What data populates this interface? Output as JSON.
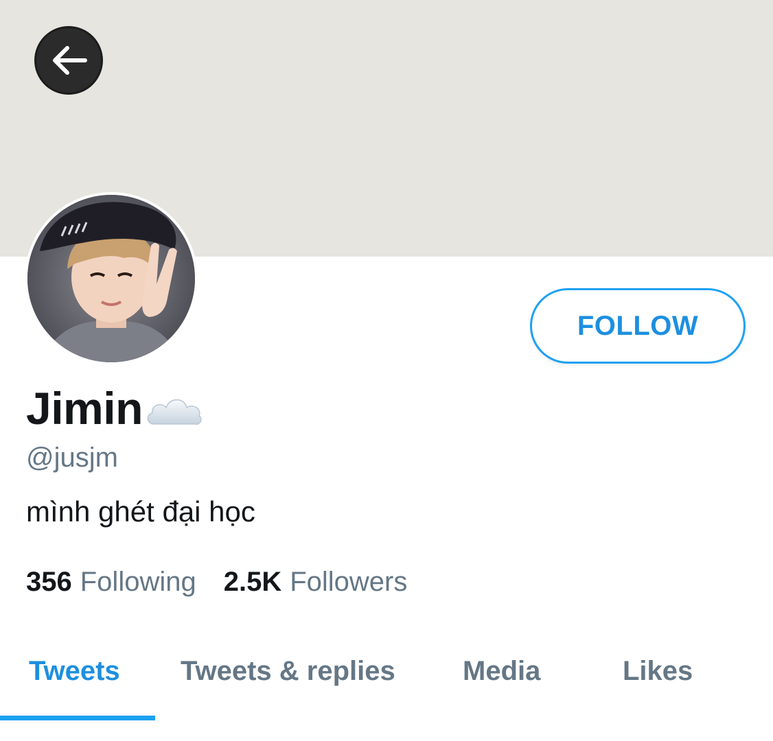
{
  "header": {
    "back_icon": "arrow-left-icon"
  },
  "profile": {
    "display_name": "Jimin",
    "name_emoji_icon": "cloud-icon",
    "handle": "@jusjm",
    "bio": "mình ghét đại học",
    "follow_label": "FOLLOW"
  },
  "stats": {
    "following_count": "356",
    "following_label": "Following",
    "followers_count": "2.5K",
    "followers_label": "Followers"
  },
  "tabs": [
    {
      "label": "Tweets",
      "active": true
    },
    {
      "label": "Tweets & replies",
      "active": false
    },
    {
      "label": "Media",
      "active": false
    },
    {
      "label": "Likes",
      "active": false
    }
  ],
  "colors": {
    "accent": "#1da1f2",
    "text_primary": "#14171a",
    "text_secondary": "#657786",
    "banner": "#e6e5e0"
  }
}
